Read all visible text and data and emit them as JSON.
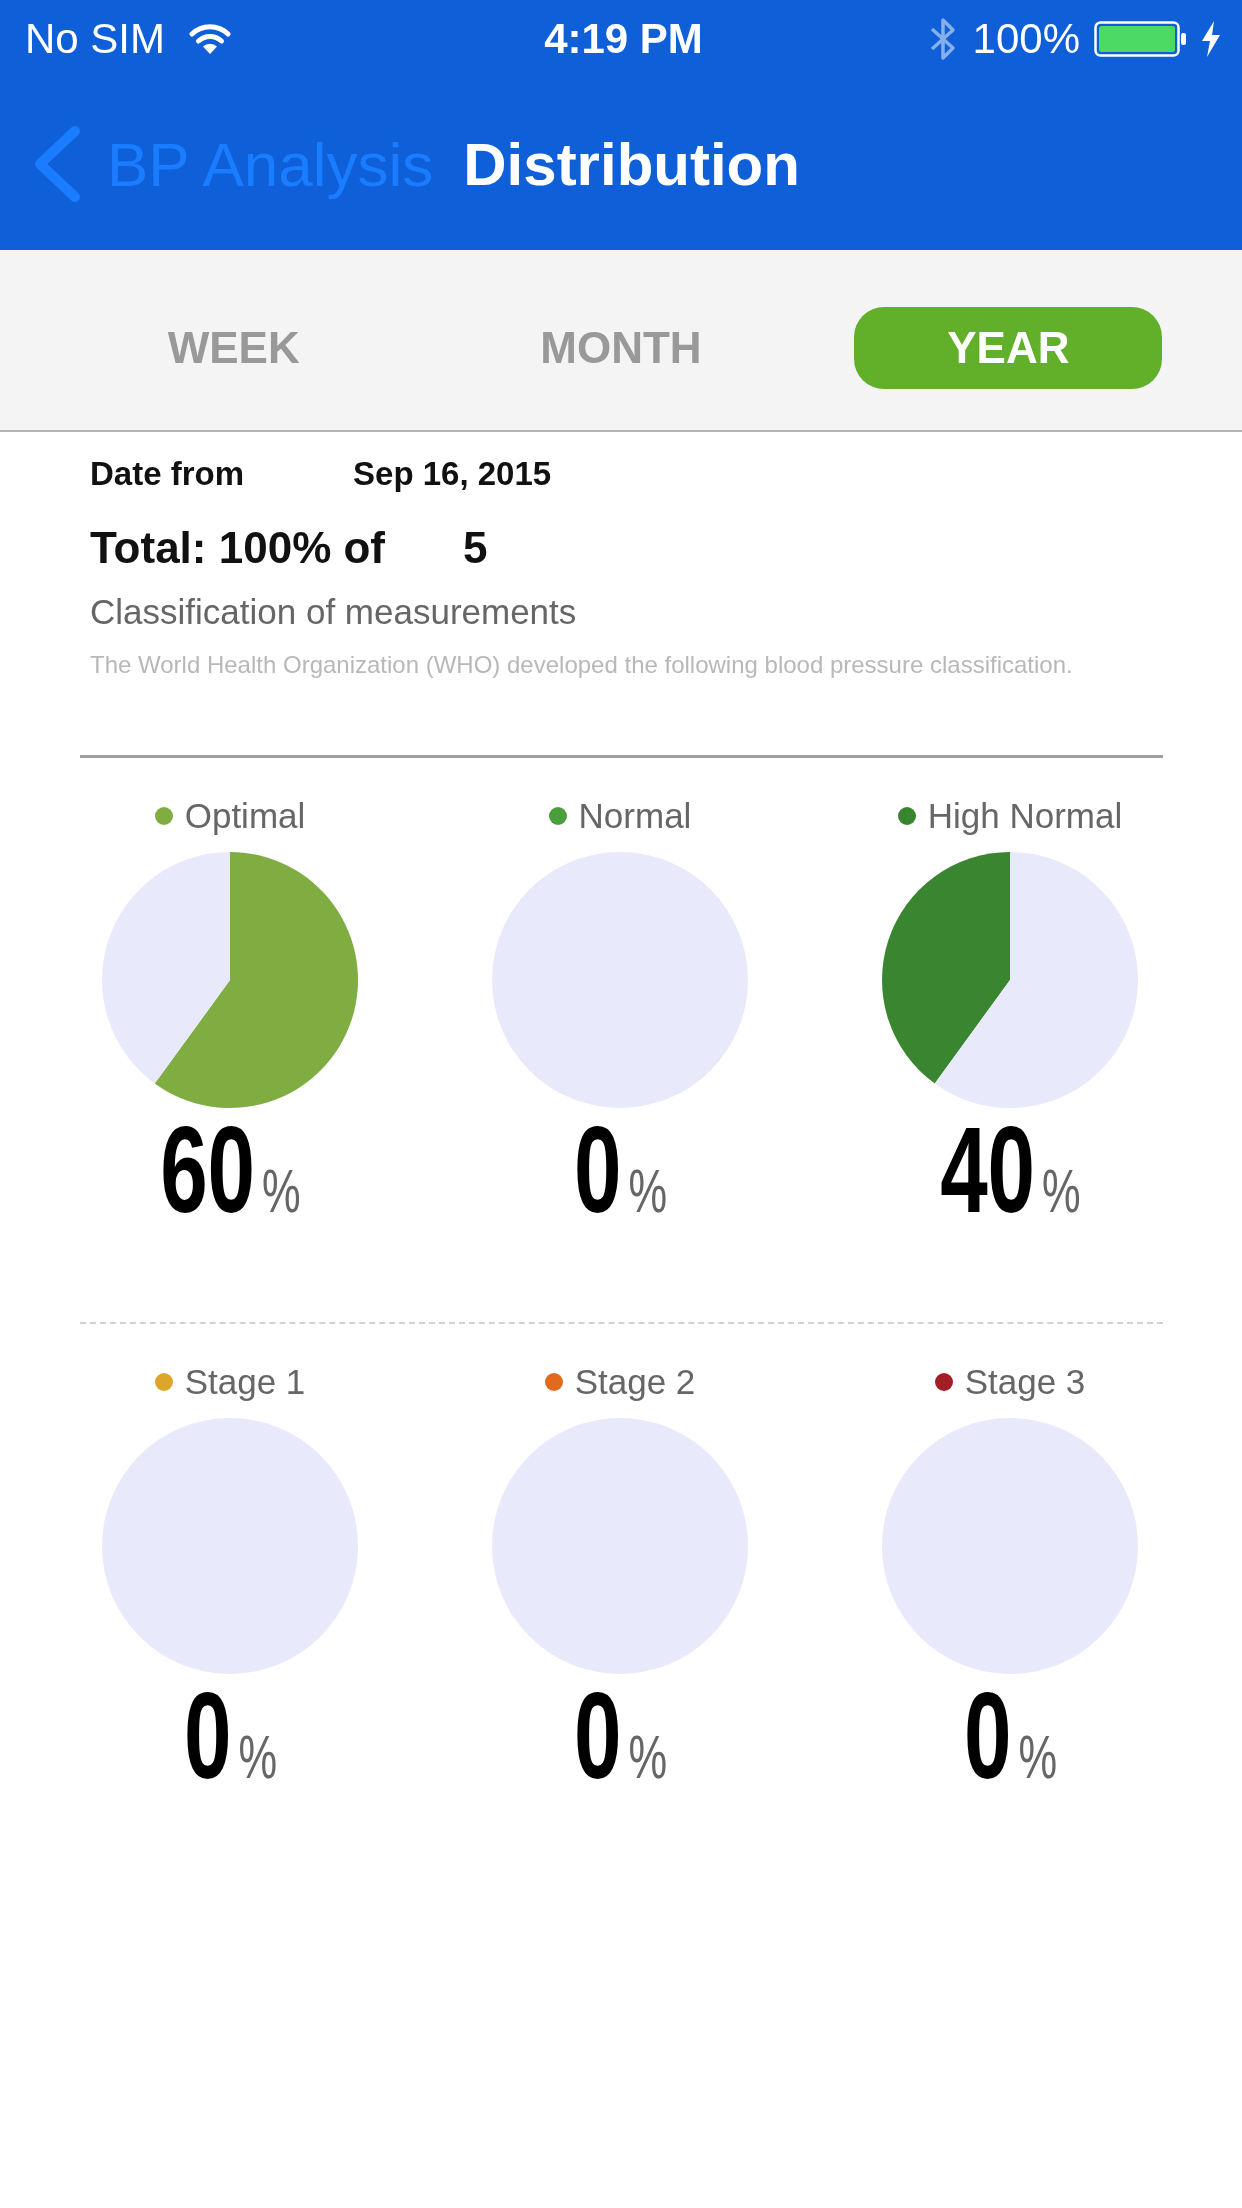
{
  "status_bar": {
    "carrier": "No SIM",
    "time": "4:19 PM",
    "battery": "100%"
  },
  "nav_bar": {
    "back_label": "BP Analysis",
    "title": "Distribution"
  },
  "tabs": [
    {
      "label": "WEEK",
      "selected": false
    },
    {
      "label": "MONTH",
      "selected": false
    },
    {
      "label": "YEAR",
      "selected": true
    }
  ],
  "summary": {
    "date_label": "Date from",
    "date_value": "Sep 16, 2015",
    "total_label": "Total: 100% of",
    "total_value": "5",
    "heading": "Classification of measurements",
    "note": "The World Health Organization (WHO) developed the following blood pressure classification."
  },
  "groups": [
    {
      "kind": "solid",
      "items": [
        {
          "label": "Optimal",
          "color": "#7fad42",
          "chart_data": {
            "type": "pie",
            "values": [
              60,
              40
            ]
          },
          "value": "60",
          "unit": "%"
        },
        {
          "label": "Normal",
          "color": "#4a9e3c",
          "chart_data": {
            "type": "pie",
            "values": [
              0,
              100
            ]
          },
          "value": "0",
          "unit": "%"
        },
        {
          "label": "High Normal",
          "color": "#3a852f",
          "chart_data": {
            "type": "pie",
            "values": [
              40,
              60
            ]
          },
          "value": "40",
          "unit": "%"
        }
      ]
    },
    {
      "kind": "dashed",
      "items": [
        {
          "label": "Stage 1",
          "color": "#dba629",
          "chart_data": {
            "type": "pie",
            "values": [
              0,
              100
            ]
          },
          "value": "0",
          "unit": "%"
        },
        {
          "label": "Stage 2",
          "color": "#e06b20",
          "chart_data": {
            "type": "pie",
            "values": [
              0,
              100
            ]
          },
          "value": "0",
          "unit": "%"
        },
        {
          "label": "Stage 3",
          "color": "#a31e26",
          "chart_data": {
            "type": "pie",
            "values": [
              0,
              100
            ]
          },
          "value": "0",
          "unit": "%"
        }
      ]
    }
  ]
}
